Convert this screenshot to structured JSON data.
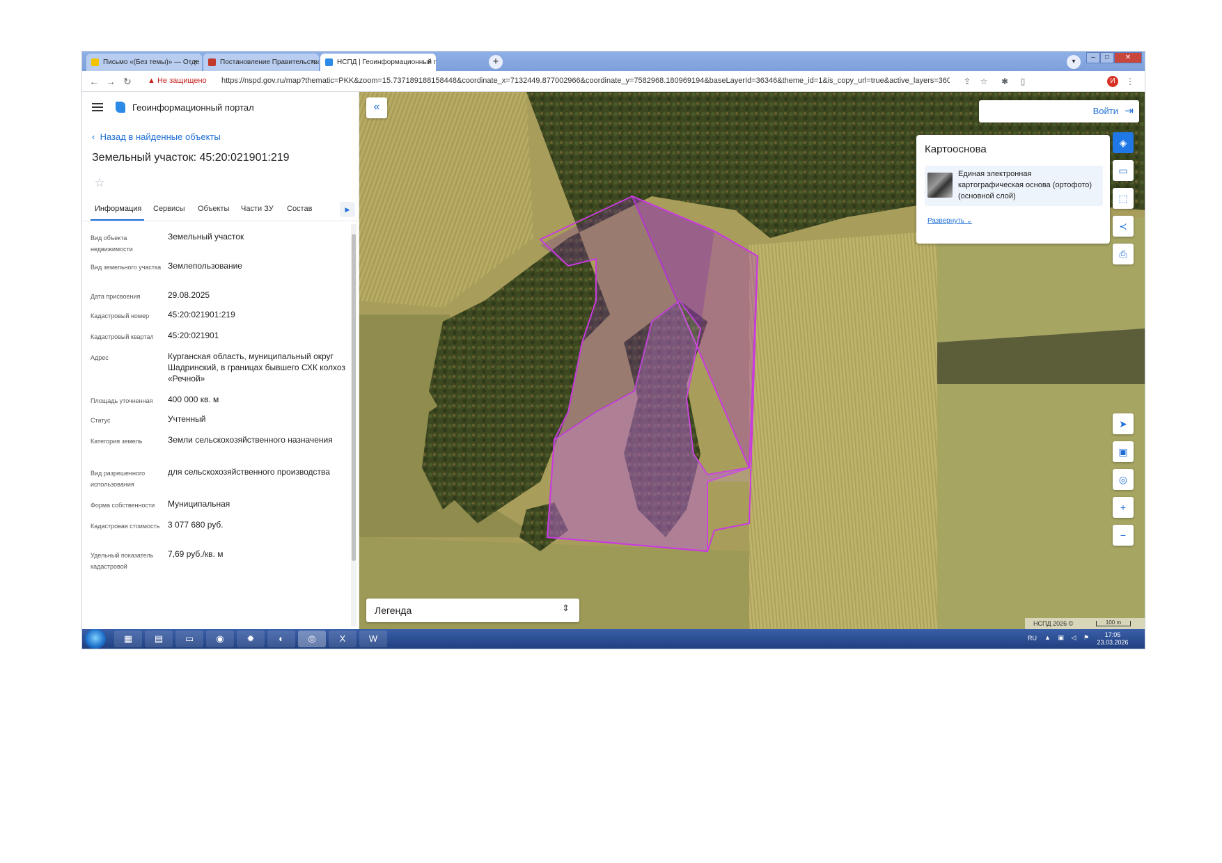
{
  "browser": {
    "tabs": [
      {
        "title": "Письмо «(Без темы)» — Отде",
        "active": false,
        "favicon_color": "#f2c400"
      },
      {
        "title": "Постановление Правительства",
        "active": false,
        "favicon_color": "#c0392b"
      },
      {
        "title": "НСПД | Геоинформационный п",
        "active": true,
        "favicon_color": "#2b8be6"
      }
    ],
    "new_tab_glyph": "+",
    "security_warning": "Не защищено",
    "url": "https://nspd.gov.ru/map?thematic=PKK&zoom=15.737189188158448&coordinate_x=7132449.877002966&coordinate_y=7582968.180969194&baseLayerId=36346&theme_id=1&is_copy_url=true&active_layers=36048&selectedCard=1...",
    "profile_initial": "И"
  },
  "portal": {
    "title": "Геоинформационный портал",
    "back_link": "Назад в найденные объекты",
    "object_title": "Земельный участок: 45:20:021901:219",
    "tabs": [
      "Информация",
      "Сервисы",
      "Объекты",
      "Части ЗУ",
      "Состав"
    ],
    "active_tab": "Информация",
    "properties": [
      {
        "label": "Вид объекта недвижимости",
        "value": "Земельный участок"
      },
      {
        "label": "Вид земельного участка",
        "value": "Землепользование"
      },
      {
        "label": "Дата присвоения",
        "value": "29.08.2025"
      },
      {
        "label": "Кадастровый номер",
        "value": "45:20:021901:219"
      },
      {
        "label": "Кадастровый квартал",
        "value": "45:20:021901"
      },
      {
        "label": "Адрес",
        "value": "Курганская область, муниципальный округ Шадринский, в границах бывшего СХК колхоз «Речной»"
      },
      {
        "label": "Площадь уточненная",
        "value": "400 000 кв. м"
      },
      {
        "label": "Статус",
        "value": "Учтенный"
      },
      {
        "label": "Категория земель",
        "value": "Земли сельскохозяйственного назначения"
      },
      {
        "label": "Вид разрешенного использования",
        "value": "для сельскохозяйственного производства"
      },
      {
        "label": "Форма собственности",
        "value": "Муниципальная"
      },
      {
        "label": "Кадастровая стоимость",
        "value": "3 077 680 руб."
      },
      {
        "label": "Удельный показатель кадастровой",
        "value": "7,69 руб./кв. м"
      }
    ]
  },
  "map": {
    "login": "Войти",
    "layers_panel": {
      "title": "Картооснова",
      "layer_name": "Единая электронная картографическая основа (ортофото) (основной слой)",
      "expand": "Развернуть"
    },
    "legend": "Легенда",
    "attribution": "НСПД 2026 ©",
    "scale": "100 m",
    "parcel_color": "#a632c8",
    "field_color": "#b3a861",
    "forest_color": "#3f4a22"
  },
  "taskbar": {
    "language": "RU",
    "time": "17:05",
    "date": "23.03.2026"
  }
}
